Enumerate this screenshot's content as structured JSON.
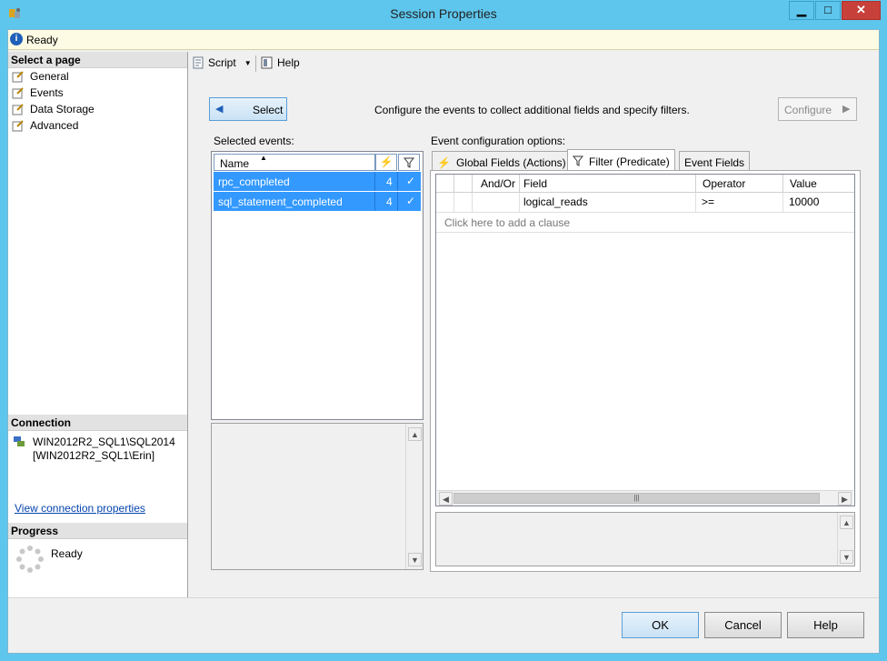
{
  "window": {
    "title": "Session Properties",
    "minimize": "▁",
    "maximize": "□",
    "close": "✕"
  },
  "status": {
    "text": "Ready"
  },
  "left": {
    "select_page_title": "Select a page",
    "pages": [
      {
        "label": "General"
      },
      {
        "label": "Events"
      },
      {
        "label": "Data Storage"
      },
      {
        "label": "Advanced"
      }
    ],
    "connection_title": "Connection",
    "connection_line1": "WIN2012R2_SQL1\\SQL2014",
    "connection_line2": "[WIN2012R2_SQL1\\Erin]",
    "view_connection": "View connection properties",
    "progress_title": "Progress",
    "progress_status": "Ready"
  },
  "toolbar": {
    "script": "Script",
    "help": "Help"
  },
  "main": {
    "select_button": "Select",
    "instruction": "Configure the events to collect additional fields and specify filters.",
    "configure_button": "Configure",
    "selected_events_label": "Selected events:",
    "event_config_label": "Event configuration options:",
    "events_columns": {
      "name": "Name"
    },
    "events": [
      {
        "name": "rpc_completed",
        "count": "4",
        "filter": "✓"
      },
      {
        "name": "sql_statement_completed",
        "count": "4",
        "filter": "✓"
      }
    ],
    "tabs": [
      {
        "label": "Global Fields (Actions)"
      },
      {
        "label": "Filter (Predicate)"
      },
      {
        "label": "Event Fields"
      }
    ],
    "filter_columns": {
      "andor": "And/Or",
      "field": "Field",
      "operator": "Operator",
      "value": "Value"
    },
    "filter_rows": [
      {
        "andor": "",
        "field": "logical_reads",
        "operator": ">=",
        "value": "10000"
      }
    ],
    "add_clause": "Click here to add a clause"
  },
  "buttons": {
    "ok": "OK",
    "cancel": "Cancel",
    "help": "Help"
  }
}
